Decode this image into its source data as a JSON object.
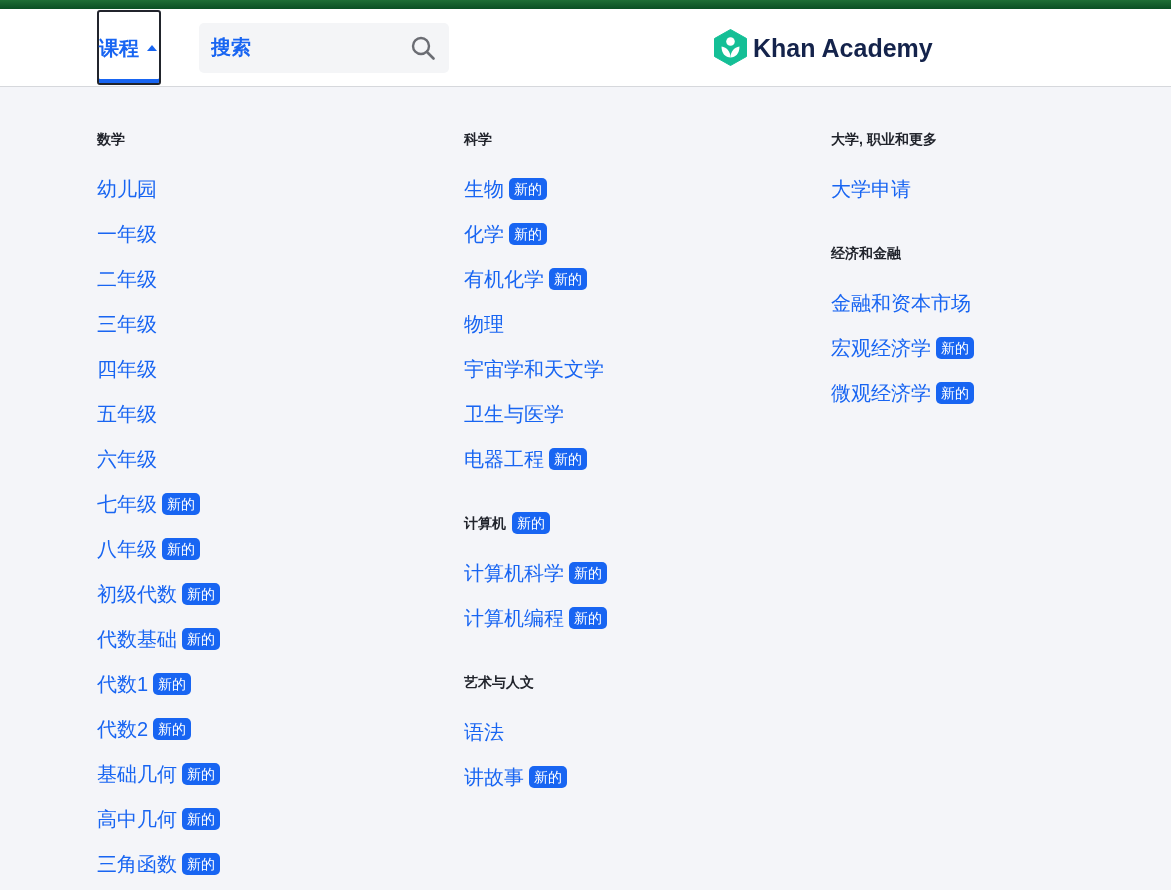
{
  "top_bar": {
    "courses_button": {
      "label": "课程",
      "expanded": true,
      "focused": true
    },
    "search": {
      "placeholder": "搜索"
    },
    "logo": {
      "text": "Khan Academy"
    }
  },
  "menu": {
    "columns": [
      {
        "groups": [
          {
            "heading": "数学",
            "items": [
              {
                "label": "幼儿园"
              },
              {
                "label": "一年级"
              },
              {
                "label": "二年级"
              },
              {
                "label": "三年级"
              },
              {
                "label": "四年级"
              },
              {
                "label": "五年级"
              },
              {
                "label": "六年级"
              },
              {
                "label": "七年级",
                "badge": "新的"
              },
              {
                "label": "八年级",
                "badge": "新的"
              },
              {
                "label": "初级代数",
                "badge": "新的"
              },
              {
                "label": "代数基础",
                "badge": "新的"
              },
              {
                "label": "代数1",
                "badge": "新的"
              },
              {
                "label": "代数2",
                "badge": "新的"
              },
              {
                "label": "基础几何",
                "badge": "新的"
              },
              {
                "label": "高中几何",
                "badge": "新的"
              },
              {
                "label": "三角函数",
                "badge": "新的"
              }
            ]
          }
        ]
      },
      {
        "groups": [
          {
            "heading": "科学",
            "items": [
              {
                "label": "生物",
                "badge": "新的"
              },
              {
                "label": "化学",
                "badge": "新的"
              },
              {
                "label": "有机化学",
                "badge": "新的"
              },
              {
                "label": "物理"
              },
              {
                "label": "宇宙学和天文学"
              },
              {
                "label": "卫生与医学"
              },
              {
                "label": "电器工程",
                "badge": "新的"
              }
            ]
          },
          {
            "heading": "计算机",
            "badge": "新的",
            "items": [
              {
                "label": "计算机科学",
                "badge": "新的"
              },
              {
                "label": "计算机编程",
                "badge": "新的"
              }
            ]
          },
          {
            "heading": "艺术与人文",
            "items": [
              {
                "label": "语法"
              },
              {
                "label": "讲故事",
                "badge": "新的"
              }
            ]
          }
        ]
      },
      {
        "groups": [
          {
            "heading": "大学, 职业和更多",
            "items": [
              {
                "label": "大学申请"
              }
            ]
          },
          {
            "heading": "经济和金融",
            "items": [
              {
                "label": "金融和资本市场"
              },
              {
                "label": "宏观经济学",
                "badge": "新的"
              },
              {
                "label": "微观经济学",
                "badge": "新的"
              }
            ]
          }
        ]
      }
    ]
  }
}
